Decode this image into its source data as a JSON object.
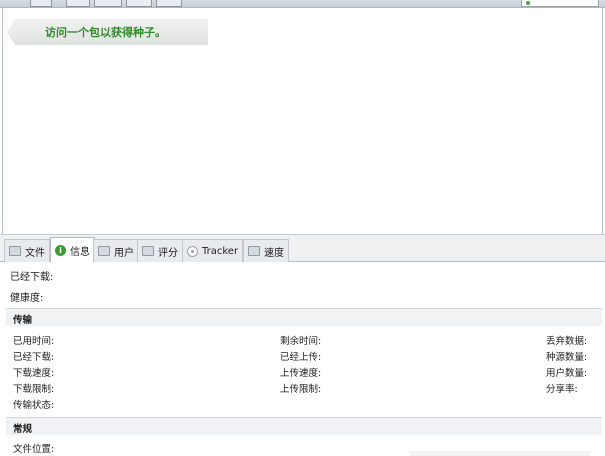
{
  "hint": {
    "text": "访问一个包以获得种子。"
  },
  "tabs": [
    {
      "label": "文件",
      "icon": "folder-icon"
    },
    {
      "label": "信息",
      "icon": "info-icon",
      "active": true
    },
    {
      "label": "用户",
      "icon": "users-icon"
    },
    {
      "label": "评分",
      "icon": "rating-icon"
    },
    {
      "label": "Tracker",
      "icon": "tracker-icon"
    },
    {
      "label": "速度",
      "icon": "speed-chart-icon"
    }
  ],
  "info": {
    "downloaded_label": "已经下载:",
    "health_label": "健康度:"
  },
  "transfer": {
    "title": "传输",
    "col1": [
      "已用时间:",
      "已经下载:",
      "下载速度:",
      "下载限制:",
      "传输状态:"
    ],
    "col2": [
      "剩余时间:",
      "已经上传:",
      "上传速度:",
      "上传限制:"
    ],
    "col3": [
      "丢弃数据:",
      "种源数量:",
      "用户数量:",
      "分享率:"
    ]
  },
  "general": {
    "title": "常规",
    "save_location_label": "文件位置:"
  }
}
